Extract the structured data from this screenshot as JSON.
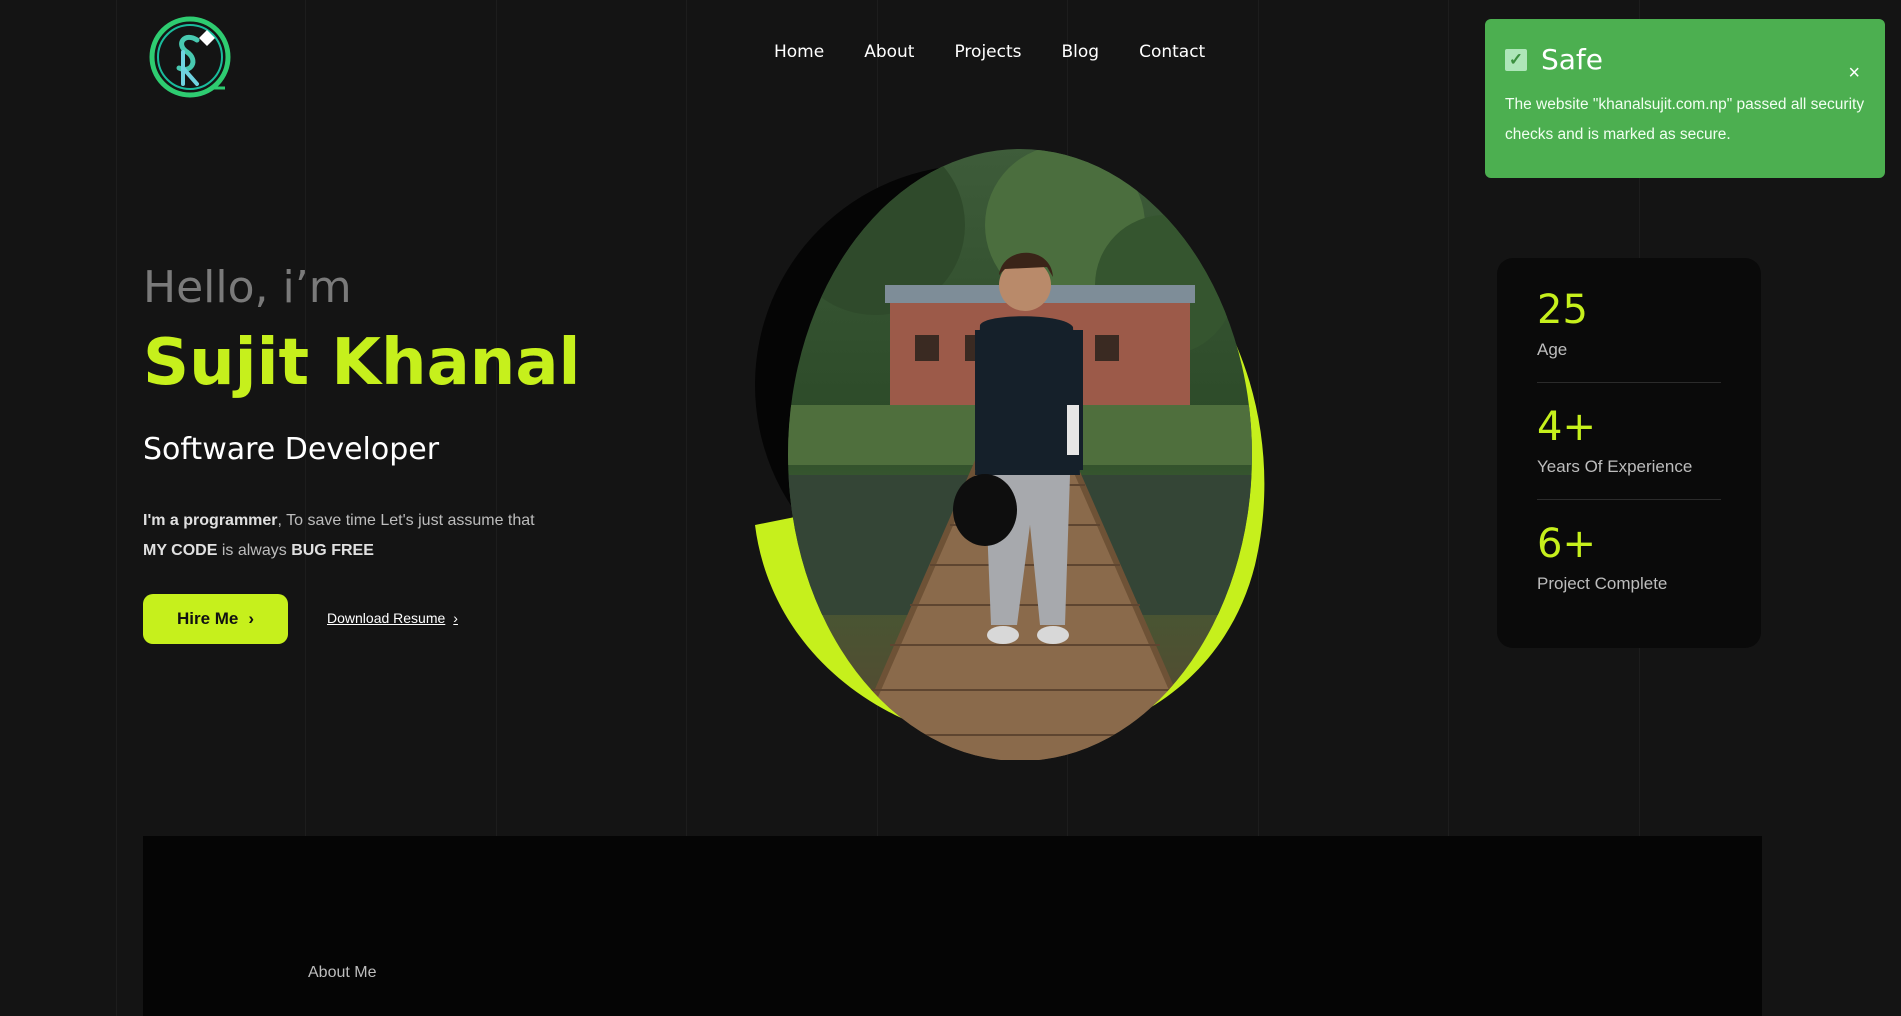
{
  "nav": {
    "items": [
      "Home",
      "About",
      "Projects",
      "Blog",
      "Contact"
    ]
  },
  "toast": {
    "title": "Safe",
    "message": "The website \"khanalsujit.com.np\" passed all security checks and is marked as secure.",
    "close": "×"
  },
  "hero": {
    "greeting": "Hello, i’m",
    "name": "Sujit Khanal",
    "role": "Software Developer",
    "bio_part1": "I'm a programmer",
    "bio_part2": ", To save time Let's just assume that ",
    "bio_part3": "MY CODE",
    "bio_part4": " is always ",
    "bio_part5": "BUG FREE",
    "hire_label": "Hire Me",
    "resume_label": "Download Resume"
  },
  "stats": [
    {
      "value": "25",
      "label": "Age"
    },
    {
      "value": "4+",
      "label": "Years Of Experience"
    },
    {
      "value": "6+",
      "label": "Project Complete"
    }
  ],
  "about": {
    "label": "About Me"
  },
  "colors": {
    "accent": "#c6f01c",
    "background": "#141414",
    "toast": "#4caf50"
  }
}
